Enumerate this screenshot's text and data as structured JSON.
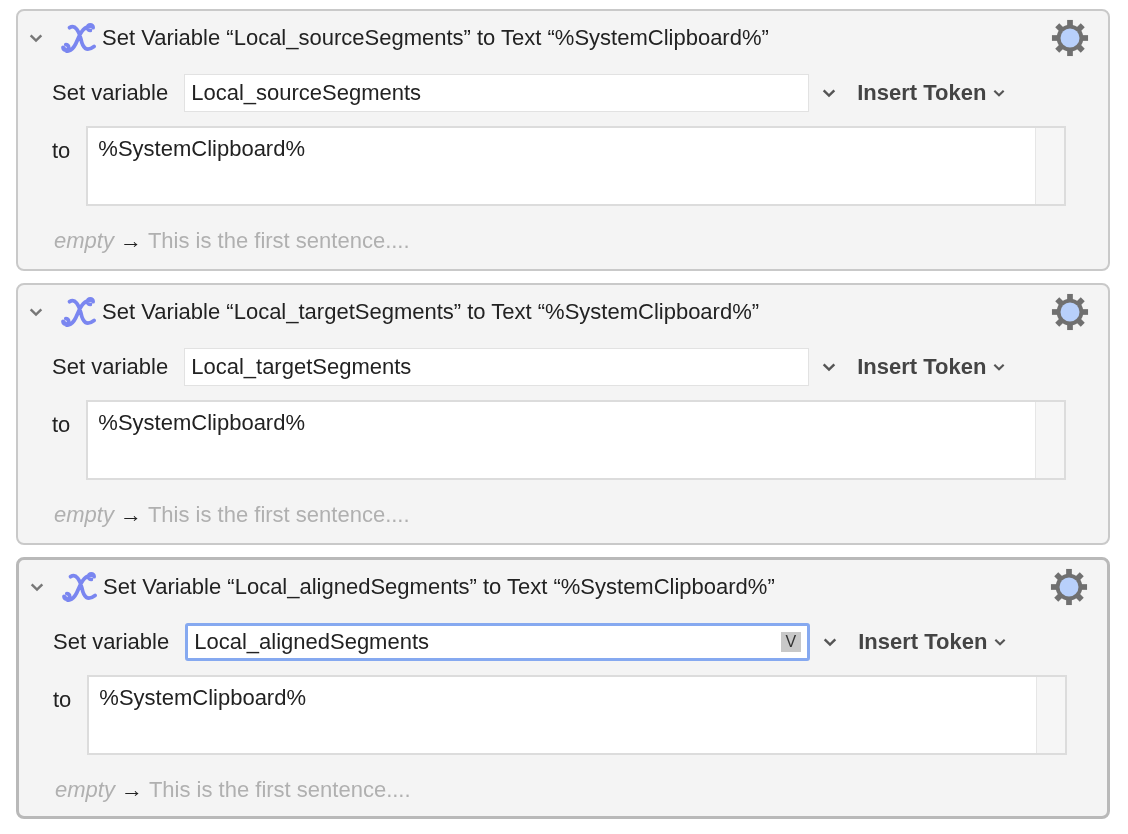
{
  "actions": [
    {
      "title": "Set Variable “Local_sourceSegments” to Text “%SystemClipboard%”",
      "expanded": true,
      "selected": false,
      "set_label": "Set variable",
      "variable": "Local_sourceSegments",
      "focused": false,
      "insert_token": "Insert Token",
      "to_label": "to",
      "text": "%SystemClipboard%",
      "preview_label": "empty",
      "preview_arrow": "→",
      "preview": "This is the first sentence...."
    },
    {
      "title": "Set Variable “Local_targetSegments” to Text “%SystemClipboard%”",
      "expanded": true,
      "selected": false,
      "set_label": "Set variable",
      "variable": "Local_targetSegments",
      "focused": false,
      "insert_token": "Insert Token",
      "to_label": "to",
      "text": "%SystemClipboard%",
      "preview_label": "empty",
      "preview_arrow": "→",
      "preview": "This is the first sentence...."
    },
    {
      "title": "Set Variable “Local_alignedSegments” to Text “%SystemClipboard%”",
      "expanded": true,
      "selected": true,
      "set_label": "Set variable",
      "variable": "Local_alignedSegments",
      "focused": true,
      "field_badge": "V",
      "insert_token": "Insert Token",
      "to_label": "to",
      "text": "%SystemClipboard%",
      "preview_label": "empty",
      "preview_arrow": "→",
      "preview": "This is the first sentence...."
    }
  ]
}
